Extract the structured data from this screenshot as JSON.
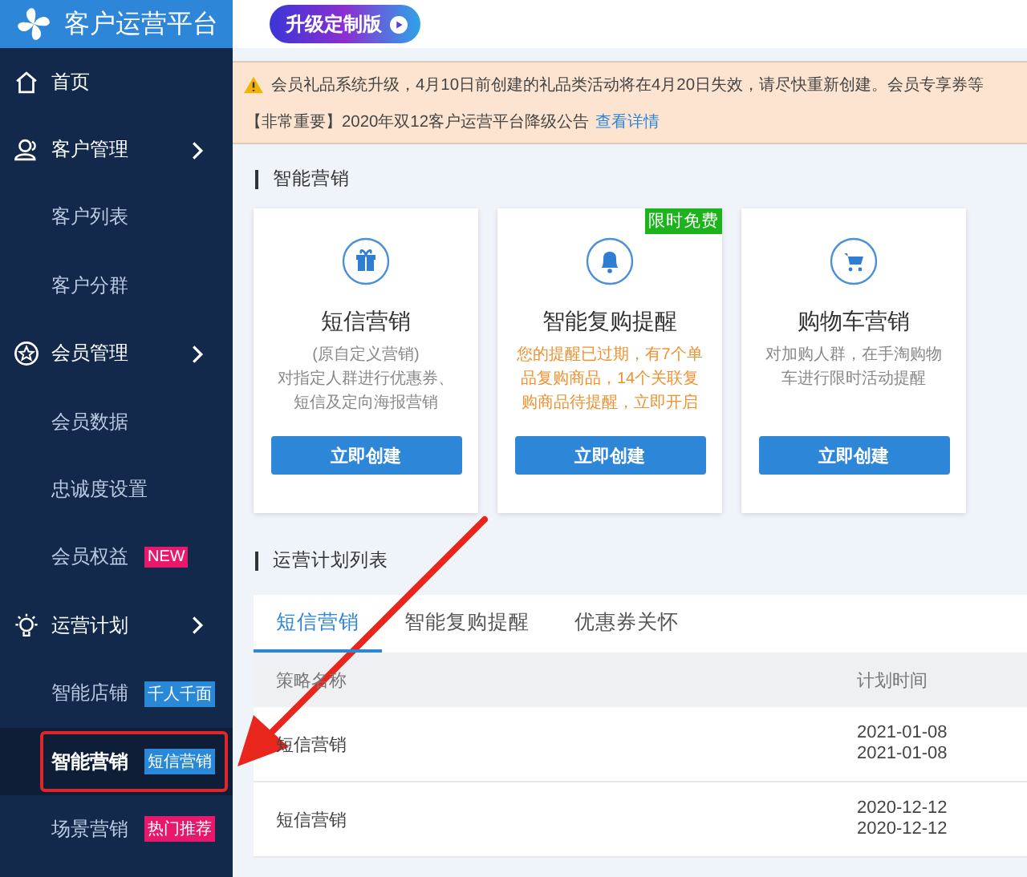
{
  "brand": {
    "title": "客户运营平台"
  },
  "upgrade_button": {
    "label": "升级定制版"
  },
  "sidebar": {
    "items": [
      {
        "label": "首页"
      },
      {
        "label": "客户管理",
        "children": [
          {
            "label": "客户列表",
            "selected": false
          },
          {
            "label": "客户分群",
            "selected": false
          }
        ]
      },
      {
        "label": "会员管理",
        "children": [
          {
            "label": "会员数据",
            "selected": false
          },
          {
            "label": "忠诚度设置",
            "selected": false
          },
          {
            "label": "会员权益",
            "selected": false,
            "badge": {
              "text": "NEW",
              "color": "#e8186c"
            }
          }
        ]
      },
      {
        "label": "运营计划",
        "children": [
          {
            "label": "智能店铺",
            "selected": false,
            "badge": {
              "text": "千人千面",
              "color": "#2a88d8"
            }
          },
          {
            "label": "智能营销",
            "selected": true,
            "badge": {
              "text": "短信营销",
              "color": "#2a88d8"
            }
          },
          {
            "label": "场景营销",
            "selected": false,
            "badge": {
              "text": "热门推荐",
              "color": "#e8186c"
            }
          }
        ]
      }
    ]
  },
  "notices": [
    {
      "kind": "warning",
      "text": "会员礼品系统升级，4月10日前创建的礼品类活动将在4月20日失效，请尽快重新创建。会员专享券等"
    },
    {
      "kind": "link",
      "text": "【非常重要】2020年双12客户运营平台降级公告",
      "link": "查看详情"
    }
  ],
  "smart_marketing": {
    "title": "智能营销",
    "cards": [
      {
        "title": "短信营销",
        "description_lines": [
          "(原自定义营销)",
          "对指定人群进行优惠券、",
          "短信及定向海报营销"
        ],
        "alert": false,
        "button": "立即创建"
      },
      {
        "title": "智能复购提醒",
        "badge": "限时免费",
        "description_lines": [
          "您的提醒已过期，有7个单",
          "品复购商品，14个关联复",
          "购商品待提醒，立即开启"
        ],
        "alert": true,
        "button": "立即创建"
      },
      {
        "title": "购物车营销",
        "description_lines": [
          "对加购人群，在手淘购物",
          "车进行限时活动提醒"
        ],
        "alert": false,
        "button": "立即创建"
      }
    ]
  },
  "plan_list": {
    "title": "运营计划列表",
    "tabs": [
      {
        "label": "短信营销",
        "selected": true
      },
      {
        "label": "智能复购提醒",
        "selected": false
      },
      {
        "label": "优惠券关怀",
        "selected": false
      }
    ],
    "columns": [
      "策略名称",
      "计划时间"
    ],
    "rows": [
      {
        "name": "短信营销",
        "times": [
          "2021-01-08",
          "2021-01-08"
        ]
      },
      {
        "name": "短信营销",
        "times": [
          "2020-12-12",
          "2020-12-12"
        ]
      }
    ]
  }
}
